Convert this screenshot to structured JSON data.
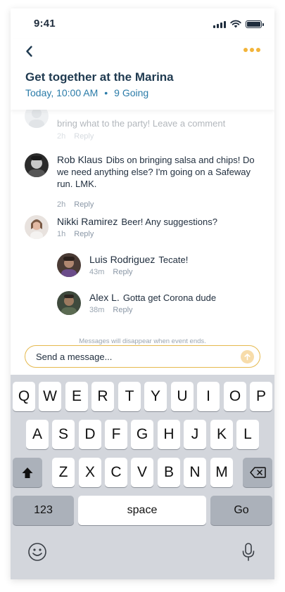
{
  "status": {
    "time": "9:41"
  },
  "header": {
    "title": "Get together at the Marina",
    "time": "Today, 10:00 AM",
    "separator": "•",
    "going": "9 Going"
  },
  "comments": [
    {
      "name": "",
      "text": "bring what to the party! Leave a comment",
      "age": "2h",
      "reply": "Reply"
    },
    {
      "name": "Rob Klaus",
      "text": "Dibs on bringing salsa and chips! Do we need anything else? I'm going on a Safeway run. LMK.",
      "age": "2h",
      "reply": "Reply"
    },
    {
      "name": "Nikki Ramirez",
      "text": "Beer! Any suggestions?",
      "age": "1h",
      "reply": "Reply"
    },
    {
      "name": "Luis Rodriguez",
      "text": "Tecate!",
      "age": "43m",
      "reply": "Reply"
    },
    {
      "name": "Alex L.",
      "text": "Gotta get Corona dude",
      "age": "38m",
      "reply": "Reply"
    }
  ],
  "notice": "Messages will disappear when event ends.",
  "composer": {
    "placeholder": "Send a message..."
  },
  "keyboard": {
    "row1": [
      "Q",
      "W",
      "E",
      "R",
      "T",
      "Y",
      "U",
      "I",
      "O",
      "P"
    ],
    "row2": [
      "A",
      "S",
      "D",
      "F",
      "G",
      "H",
      "J",
      "K",
      "L"
    ],
    "row3": [
      "Z",
      "X",
      "C",
      "V",
      "B",
      "N",
      "M"
    ],
    "numbers": "123",
    "space": "space",
    "go": "Go"
  },
  "colors": {
    "accent": "#f2b43a",
    "link": "#2a7ba8",
    "title": "#1f3a50"
  }
}
